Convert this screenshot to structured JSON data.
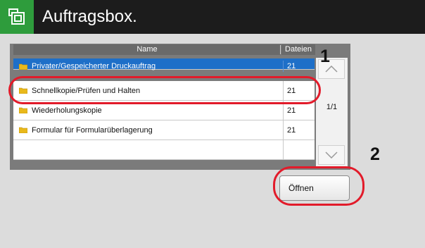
{
  "window": {
    "title": "Auftragsbox.",
    "icon": "job-box-icon",
    "accent": "#2e9c3c"
  },
  "table": {
    "columns": [
      "Name",
      "Dateien"
    ],
    "rows": [
      {
        "name": "Privater/Gespeicherter Druckauftrag",
        "files": "21",
        "selected": true
      },
      {
        "name": "Schnellkopie/Prüfen und Halten",
        "files": "21",
        "selected": false
      },
      {
        "name": "Wiederholungskopie",
        "files": "21",
        "selected": false
      },
      {
        "name": "Formular für Formularüberlagerung",
        "files": "21",
        "selected": false
      },
      {
        "name": "",
        "files": "",
        "selected": false
      }
    ],
    "selection_color": "#1e6fc8"
  },
  "pager": {
    "page": "1/1"
  },
  "actions": {
    "open_label": "Öffnen"
  },
  "callouts": {
    "one": "1",
    "two": "2",
    "color": "#e21b2a"
  }
}
